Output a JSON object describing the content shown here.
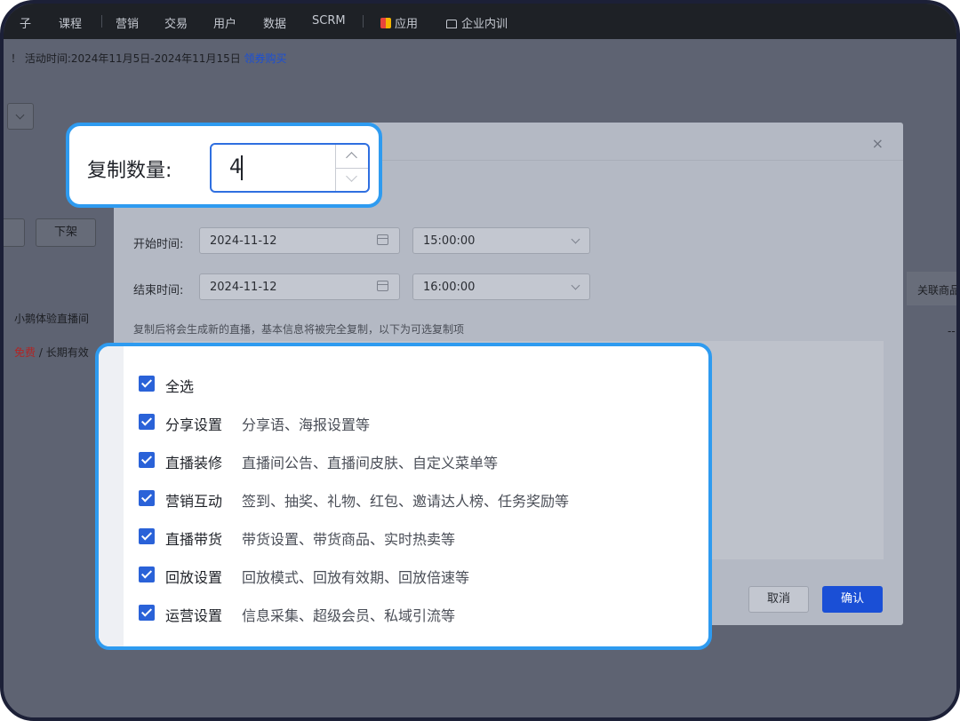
{
  "topnav": {
    "items": [
      "子",
      "课程",
      "营销",
      "交易",
      "用户",
      "数据",
      "SCRM",
      "应用",
      "企业内训"
    ]
  },
  "notice": {
    "text": "！ 活动时间:2024年11月5日-2024年11月15日",
    "link": "领券购买"
  },
  "background": {
    "takedown_button": "下架",
    "room_name": "小鹅体验直播间",
    "price_free": "免费",
    "validity": "/ 长期有效",
    "linked_goods_header": "关联商品",
    "dash": "--"
  },
  "dialog": {
    "close_icon": "×",
    "start": {
      "label": "开始时间:",
      "date": "2024-11-12",
      "time": "15:00:00"
    },
    "end": {
      "label": "结束时间:",
      "date": "2024-11-12",
      "time": "16:00:00"
    },
    "hint": "复制后将会生成新的直播，基本信息将被完全复制，以下为可选复制项",
    "cancel": "取消",
    "confirm": "确认"
  },
  "copy_quantity": {
    "label": "复制数量:",
    "value": "4"
  },
  "options": [
    {
      "title": "全选",
      "desc": "",
      "checked": true
    },
    {
      "title": "分享设置",
      "desc": "分享语、海报设置等",
      "checked": true
    },
    {
      "title": "直播装修",
      "desc": "直播间公告、直播间皮肤、自定义菜单等",
      "checked": true
    },
    {
      "title": "营销互动",
      "desc": "签到、抽奖、礼物、红包、邀请达人榜、任务奖励等",
      "checked": true
    },
    {
      "title": "直播带货",
      "desc": "带货设置、带货商品、实时热卖等",
      "checked": true
    },
    {
      "title": "回放设置",
      "desc": "回放模式、回放有效期、回放倍速等",
      "checked": true
    },
    {
      "title": "运营设置",
      "desc": "信息采集、超级会员、私域引流等",
      "checked": true
    }
  ],
  "colors": {
    "accent": "#2e9bf0",
    "primary_button": "#1a4fd6",
    "checkbox": "#2a62d8"
  }
}
